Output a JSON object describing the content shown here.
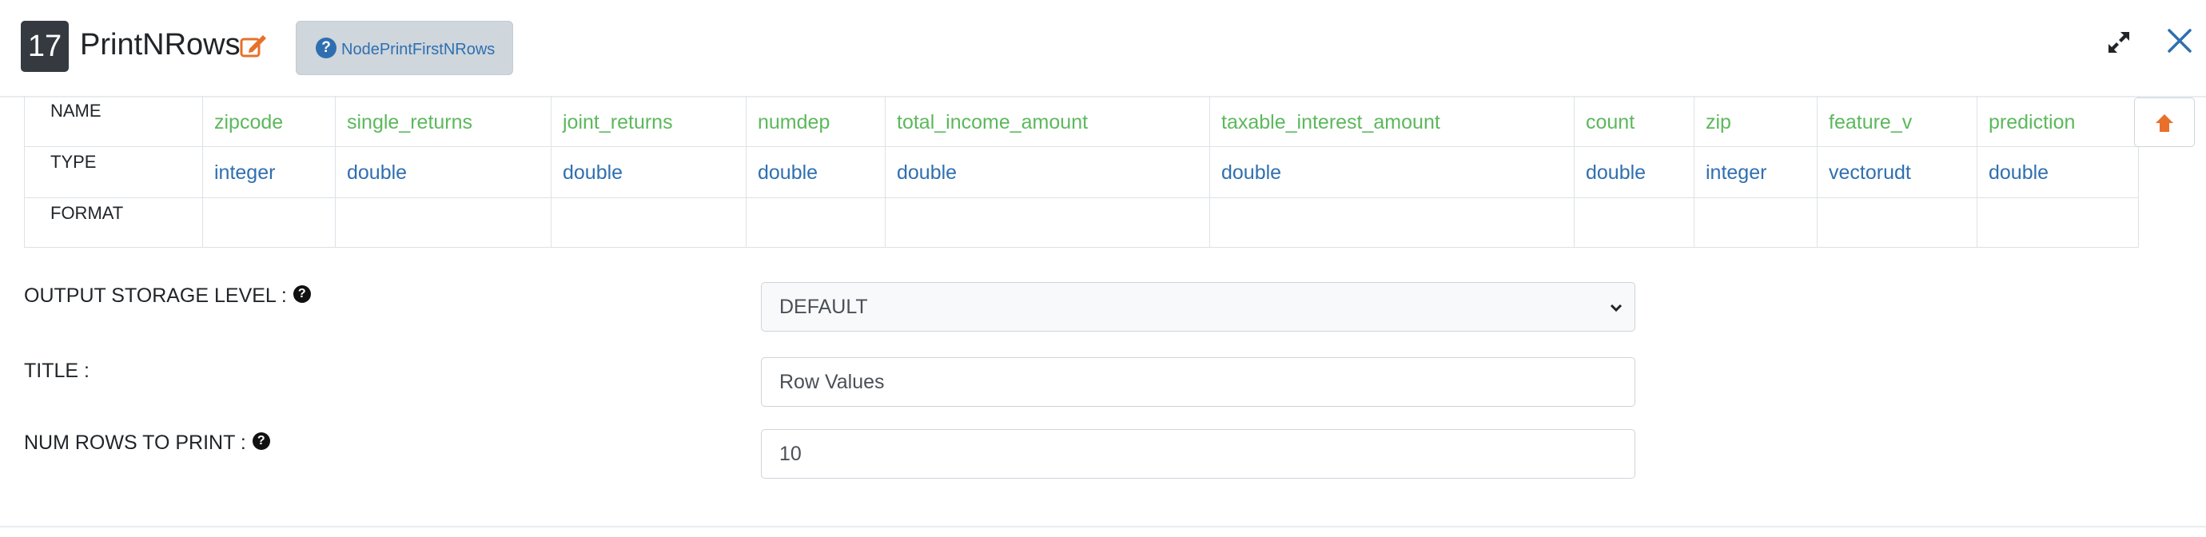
{
  "header": {
    "node_number": "17",
    "node_title": "PrintNRows",
    "help_button_label": "NodePrintFirstNRows"
  },
  "schema": {
    "row_labels": [
      "NAME",
      "TYPE",
      "FORMAT"
    ],
    "columns": [
      {
        "name": "zipcode",
        "type": "integer",
        "format": ""
      },
      {
        "name": "single_returns",
        "type": "double",
        "format": ""
      },
      {
        "name": "joint_returns",
        "type": "double",
        "format": ""
      },
      {
        "name": "numdep",
        "type": "double",
        "format": ""
      },
      {
        "name": "total_income_amount",
        "type": "double",
        "format": ""
      },
      {
        "name": "taxable_interest_amount",
        "type": "double",
        "format": ""
      },
      {
        "name": "count",
        "type": "double",
        "format": ""
      },
      {
        "name": "zip",
        "type": "integer",
        "format": ""
      },
      {
        "name": "feature_v",
        "type": "vectorudt",
        "format": ""
      },
      {
        "name": "prediction",
        "type": "double",
        "format": ""
      }
    ]
  },
  "form": {
    "storage_level": {
      "label": "OUTPUT STORAGE LEVEL :",
      "value": "DEFAULT"
    },
    "title": {
      "label": "TITLE :",
      "value": "Row Values"
    },
    "num_rows": {
      "label": "NUM ROWS TO PRINT :",
      "value": "10"
    }
  },
  "icons": {
    "edit": "edit-icon",
    "help": "question-circle-icon",
    "expand": "expand-icon",
    "close": "close-icon",
    "scroll_up": "arrow-up-icon"
  },
  "colors": {
    "column_name": "#5cb85c",
    "column_type": "#2f6fb0",
    "edit_icon": "#e8702a",
    "close_icon": "#2f6fb0"
  }
}
